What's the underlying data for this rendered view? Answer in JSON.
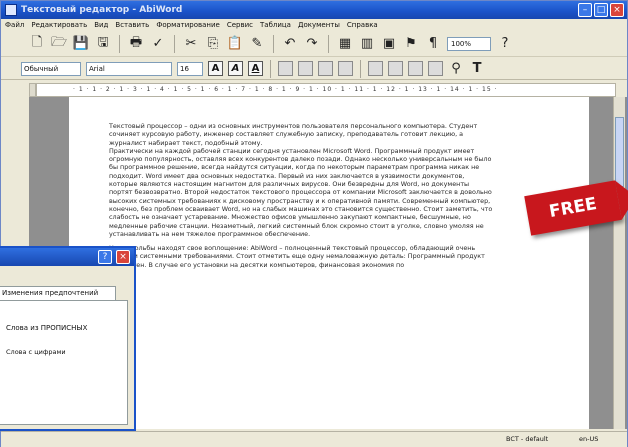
{
  "window": {
    "title": "Текстовый редактор - AbiWord",
    "buttons": {
      "minimize": "–",
      "maximize": "□",
      "close": "×"
    }
  },
  "menubar": {
    "items": [
      "Файл",
      "Редактировать",
      "Вид",
      "Вставить",
      "Форматирование",
      "Сервис",
      "Таблица",
      "Документы",
      "Справка"
    ]
  },
  "toolbar": {
    "icons": [
      "new-document-icon",
      "open-folder-icon",
      "save-icon",
      "save-as-icon",
      "print-icon",
      "spellcheck-icon",
      "cut-icon",
      "copy-icon",
      "paste-icon",
      "format-painter-icon",
      "undo-icon",
      "redo-icon",
      "table-icon",
      "columns-icon",
      "image-icon",
      "hyperlink-icon",
      "paragraph-icon",
      "help-icon"
    ],
    "zoom": "100%"
  },
  "format_bar": {
    "style": "Обычный",
    "font": "Arial",
    "size": "16",
    "bold": "A",
    "italic": "A",
    "underline": "A",
    "text_color_icon": "T"
  },
  "ruler": {
    "marks": "· 1 · 1 · 2 · 1 · 3 · 1 · 4 · 1 · 5 · 1 · 6 · 1 · 7 · 1 · 8 · 1 · 9 · 1 · 10 · 1 · 11 · 1 · 12 · 1 · 13 · 1 · 14 · 1 · 15 ·"
  },
  "document": {
    "paragraphs": [
      "Текстовый процессор – одни из основных инструментов пользователя персонального компьютера. Студент сочиняет курсовую работу, инженер составляет служебную записку, преподаватель готовит лекцию, а журналист набирает текст, подобный этому.",
      "Практически на каждой рабочей станции сегодня установлен Microsoft Word. Программный продукт имеет огромную популярность, оставляя всех конкурентов далеко позади. Однако несколько универсальным не было бы программное решение, всегда найдутся ситуации, когда по некоторым параметрам программа никак не подходит. Word имеет два основных недостатка. Первый из них заключается в уязвимости документов, которые являются настоящим магнитом для различных вирусов. Они безвредны для Word, но документы портят безвозвратно. Второй недостаток текстового процессора от компании Microsoft заключается в довольно высоких системных требованиях к дисковому пространству и к оперативной памяти. Современный компьютер, конечно, без проблем осваивает Word, но на слабых машинах это становится существенно. Стоит заметить, что слабость не означает устаревание. Множество офисов умышленно закупают компактные, бесшумные, но медленные рабочие станции. Незаметный, легкий системный блок скромно стоит в уголке, словно умоляя не устанавливать на нем тяжелое программное обеспечение.",
      "Наши мольбы находят свое воплощение: AbiWord – полноценный текстовый процессор, обладающий очень низкими системными требованиями. Стоит отметить еще одну немаловажную деталь: Программный продукт бесплатен. В случае его установки на десятки компьютеров, финансовая экономия по"
    ]
  },
  "dialog": {
    "help": "?",
    "close": "×",
    "tab_label": "Изменения предпочтений",
    "option1": "Слова из ПРОПИСНЫХ",
    "option2": "Слова с цифрами"
  },
  "statusbar": {
    "language": "BCT - default",
    "position": "en-US"
  },
  "badge": {
    "text": "FREE"
  }
}
